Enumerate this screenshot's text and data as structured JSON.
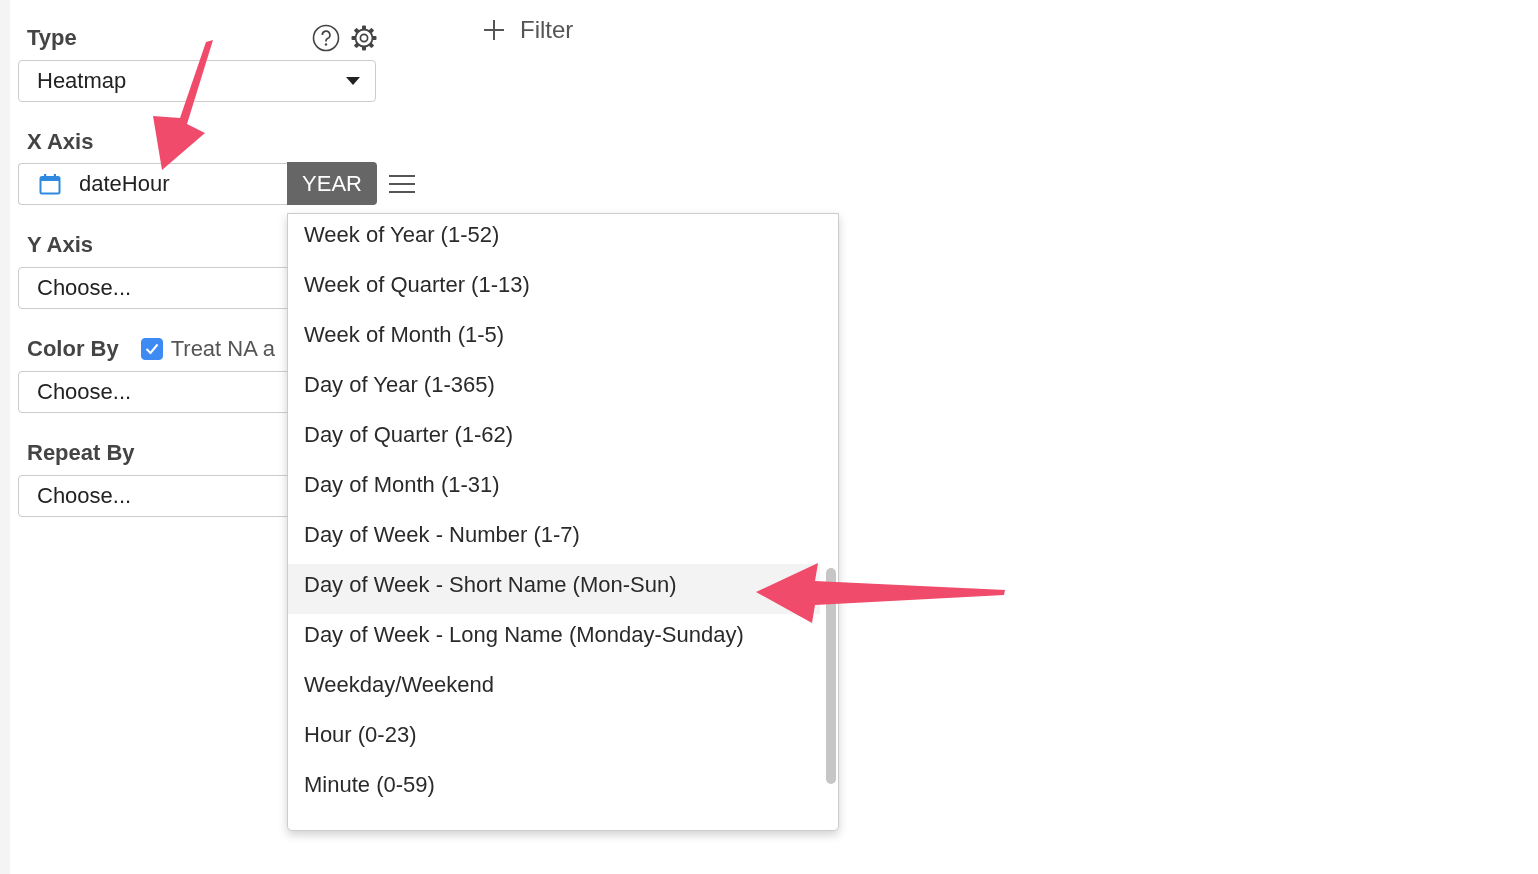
{
  "type_field": {
    "label": "Type",
    "value": "Heatmap"
  },
  "filter_button": {
    "label": "Filter"
  },
  "x_axis": {
    "label": "X Axis",
    "column": "dateHour",
    "unit": "YEAR"
  },
  "y_axis": {
    "label": "Y Axis",
    "placeholder": "Choose..."
  },
  "color_by": {
    "label": "Color By",
    "checkbox": {
      "label": "Treat NA a",
      "checked": true
    },
    "placeholder": "Choose..."
  },
  "repeat_by": {
    "label": "Repeat By",
    "placeholder": "Choose..."
  },
  "unit_menu": {
    "items": [
      {
        "label": "Week of Year (1-52)",
        "selected": false
      },
      {
        "label": "Week of Quarter (1-13)",
        "selected": false
      },
      {
        "label": "Week of Month (1-5)",
        "selected": false
      },
      {
        "label": "Day of Year (1-365)",
        "selected": false
      },
      {
        "label": "Day of Quarter (1-62)",
        "selected": false
      },
      {
        "label": "Day of Month (1-31)",
        "selected": false
      },
      {
        "label": "Day of Week - Number (1-7)",
        "selected": false
      },
      {
        "label": "Day of Week - Short Name (Mon-Sun)",
        "selected": true
      },
      {
        "label": "Day of Week - Long Name (Monday-Sunday)",
        "selected": false
      },
      {
        "label": "Weekday/Weekend",
        "selected": false
      },
      {
        "label": "Hour (0-23)",
        "selected": false
      },
      {
        "label": "Minute (0-59)",
        "selected": false
      }
    ]
  }
}
